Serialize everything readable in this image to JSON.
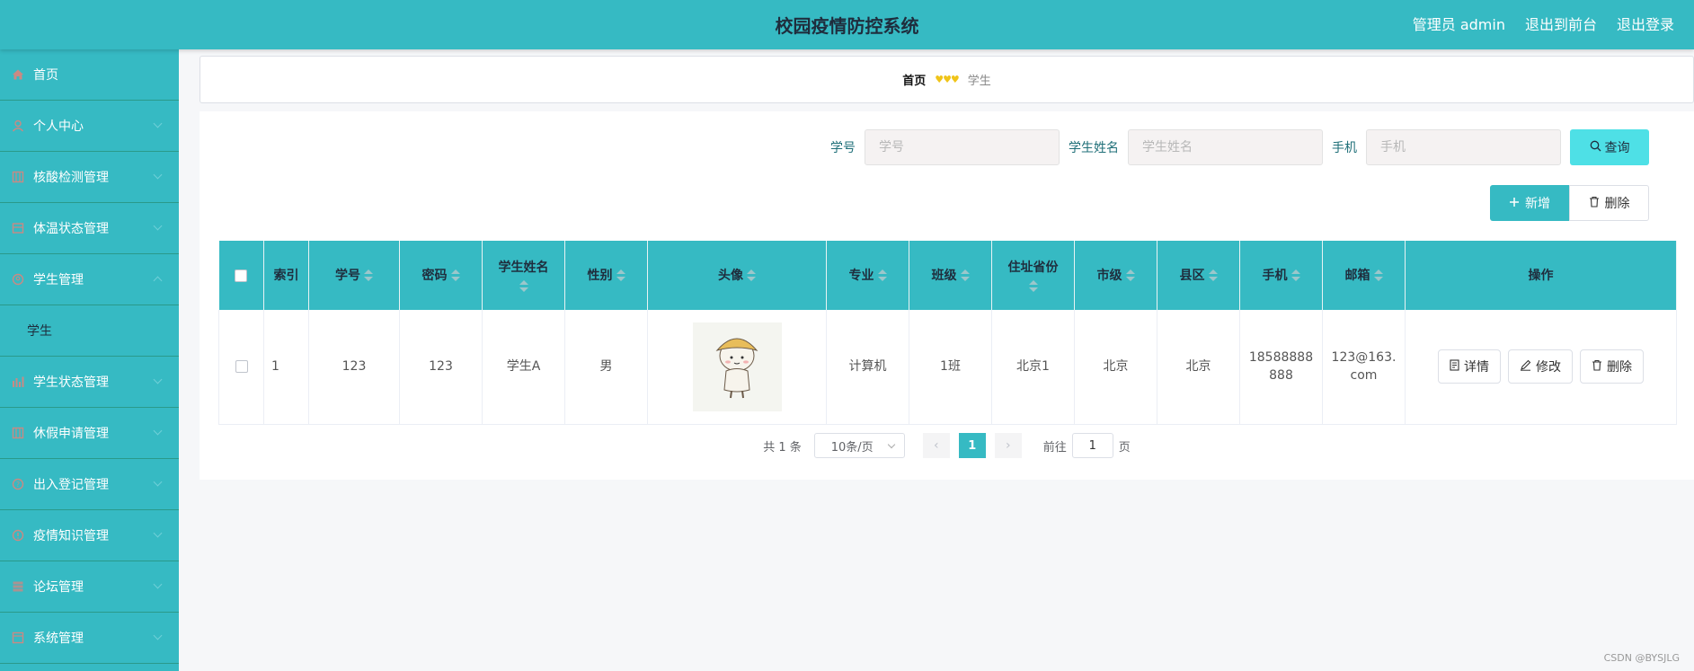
{
  "header": {
    "title": "校园疫情防控系统",
    "admin_label": "管理员 admin",
    "front_link": "退出到前台",
    "logout_link": "退出登录"
  },
  "sidebar": {
    "items": [
      {
        "label": "首页",
        "icon": "home-icon"
      },
      {
        "label": "个人中心",
        "icon": "user-icon"
      },
      {
        "label": "核酸检测管理",
        "icon": "list-icon"
      },
      {
        "label": "体温状态管理",
        "icon": "thermometer-icon"
      },
      {
        "label": "学生管理",
        "icon": "people-icon"
      },
      {
        "label": "学生",
        "icon": ""
      },
      {
        "label": "学生状态管理",
        "icon": "bar-chart-icon"
      },
      {
        "label": "休假申请管理",
        "icon": "list-icon"
      },
      {
        "label": "出入登记管理",
        "icon": "help-icon"
      },
      {
        "label": "疫情知识管理",
        "icon": "info-icon"
      },
      {
        "label": "论坛管理",
        "icon": "grid-icon"
      },
      {
        "label": "系统管理",
        "icon": "settings-icon"
      }
    ]
  },
  "breadcrumb": {
    "home": "首页",
    "separator": "♥♥♥",
    "current": "学生"
  },
  "search": {
    "fields": [
      {
        "label": "学号",
        "placeholder": "学号"
      },
      {
        "label": "学生姓名",
        "placeholder": "学生姓名"
      },
      {
        "label": "手机",
        "placeholder": "手机"
      }
    ],
    "button": "查询"
  },
  "actions": {
    "add": "新增",
    "delete": "删除"
  },
  "table": {
    "columns": [
      "索引",
      "学号",
      "密码",
      "学生姓名",
      "性别",
      "头像",
      "专业",
      "班级",
      "住址省份",
      "市级",
      "县区",
      "手机",
      "邮箱",
      "操作"
    ],
    "rows": [
      {
        "index": "1",
        "student_id": "123",
        "password": "123",
        "name": "学生A",
        "gender": "男",
        "major": "计算机",
        "class": "1班",
        "province": "北京1",
        "city": "北京",
        "county": "北京",
        "phone": "18588888888",
        "email": "123@163.com"
      }
    ],
    "row_actions": {
      "detail": "详情",
      "edit": "修改",
      "delete": "删除"
    }
  },
  "pagination": {
    "total_text": "共 1 条",
    "page_size": "10条/页",
    "current_page": "1",
    "goto_label": "前往",
    "goto_value": "1",
    "page_suffix": "页"
  },
  "watermark": "CSDN @BYSJLG",
  "colors": {
    "primary": "#36bac3",
    "search_button": "#4ee0e6"
  }
}
